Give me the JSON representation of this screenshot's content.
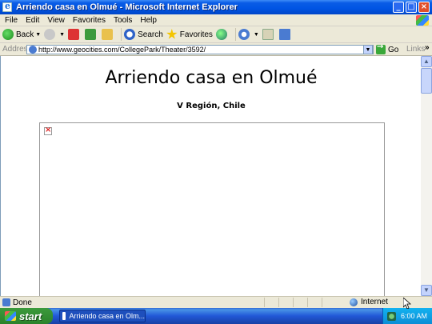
{
  "window": {
    "title": "Arriendo casa en Olmué - Microsoft Internet Explorer",
    "buttons": [
      "_",
      "□",
      "×"
    ]
  },
  "menu": {
    "items": [
      "File",
      "Edit",
      "View",
      "Favorites",
      "Tools",
      "Help"
    ]
  },
  "toolbar": {
    "back_label": "Back",
    "search_label": "Search",
    "favorites_label": "Favorites"
  },
  "address": {
    "label": "Address",
    "url": "http://www.geocities.com/CollegePark/Theater/3592/",
    "go_label": "Go",
    "links_label": "Links",
    "links_more": "»"
  },
  "page": {
    "heading": "Arriendo casa en Olmué",
    "subheading": "V Región, Chile"
  },
  "status": {
    "text": "Done",
    "zone": "Internet"
  },
  "taskbar": {
    "start_label": "start",
    "task_item": "Arriendo casa en Olm...",
    "clock": "6:00 AM"
  }
}
